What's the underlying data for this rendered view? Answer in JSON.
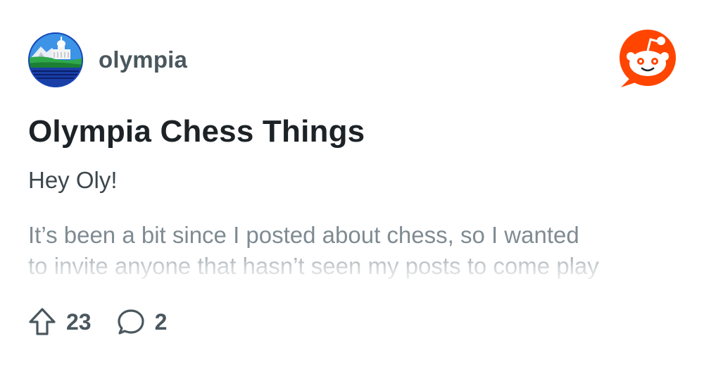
{
  "post": {
    "subreddit": "olympia",
    "title": "Olympia Chess Things",
    "body_intro": "Hey Oly!",
    "body_lines": [
      "It’s been a bit since I posted about chess, so I wanted",
      "to invite anyone that hasn’t seen my posts to come play"
    ],
    "upvotes": "23",
    "comments": "2"
  },
  "colors": {
    "reddit_orange": "#FF4500",
    "text_primary": "#1c2226",
    "text_secondary": "#4a575e",
    "text_muted": "#7f8b92"
  },
  "icons": {
    "avatar": "olympia-capitol-avatar",
    "brand": "reddit-snoo-logo-icon",
    "upvote": "upvote-arrow-icon",
    "comment": "comment-bubble-icon"
  }
}
